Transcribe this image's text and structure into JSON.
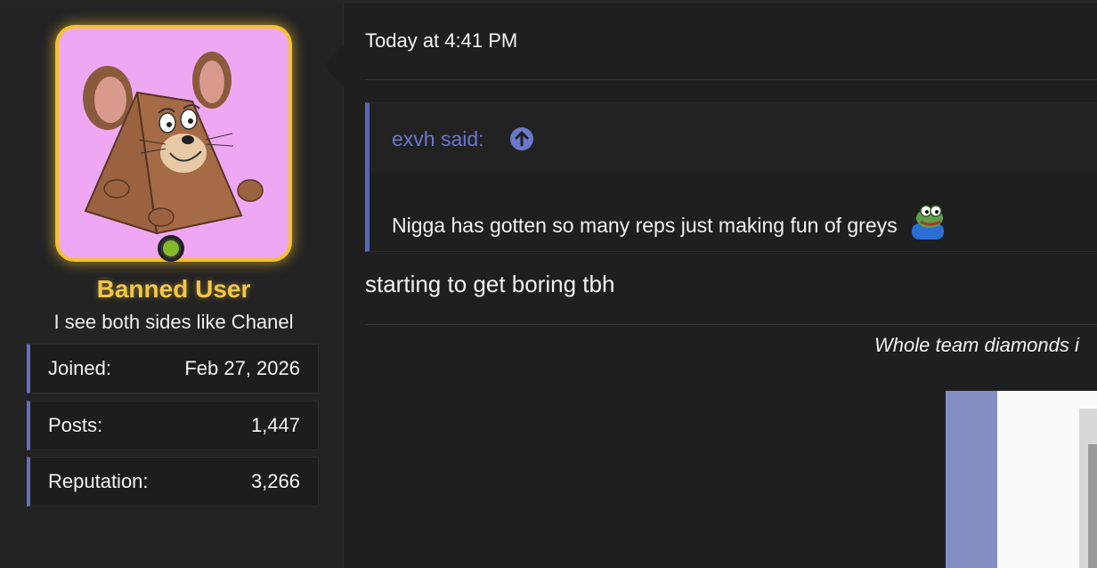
{
  "post": {
    "timestamp": "Today at 4:41 PM",
    "quote": {
      "author": "exvh said:",
      "text": "Nigga has gotten so many reps just making fun of greys"
    },
    "body": "starting to get boring tbh",
    "signature": "Whole team diamonds i"
  },
  "user": {
    "name": "Banned User",
    "title": "I see both sides like Chanel",
    "stats": [
      {
        "label": "Joined:",
        "value": "Feb 27, 2026"
      },
      {
        "label": "Posts:",
        "value": "1,447"
      },
      {
        "label": "Reputation:",
        "value": "3,266"
      }
    ]
  },
  "colors": {
    "accent": "#5f6fbf",
    "username": "#f4c64a",
    "online": "#86b82b",
    "avatar_bg": "#efa7f3"
  },
  "icons": {
    "jump": "arrow-up-circle-icon",
    "emoji": "pepe-emoji-icon"
  }
}
